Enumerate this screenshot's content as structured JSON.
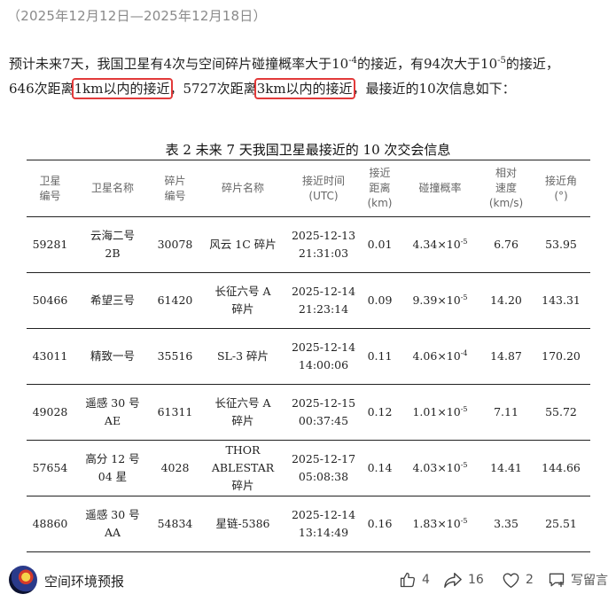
{
  "date_range": "（2025年12月12日—2025年12月18日）",
  "intro": {
    "p1": "预计未来7天，我国卫星有4次与空间碎片碰撞概率大于10",
    "exp1": "-4",
    "p2": "的接近，有94次大于10",
    "exp2": "-5",
    "p3": "的接近，",
    "p4": "646次距离",
    "highlight1": "1km以内的接近",
    "p5": "，5727次距离",
    "highlight2": "3km以内的接近",
    "p6": "，最接近的10次信息如下："
  },
  "table": {
    "title": "表 2  未来 7 天我国卫星最接近的 10 次交会信息",
    "headers": {
      "sat_id": [
        "卫星",
        "编号"
      ],
      "sat_name": [
        "卫星名称"
      ],
      "debris_id": [
        "碎片",
        "编号"
      ],
      "debris_name": [
        "碎片名称"
      ],
      "time": [
        "接近时间",
        "(UTC)"
      ],
      "distance": [
        "接近",
        "距离",
        "(km)"
      ],
      "probability": [
        "碰撞概率"
      ],
      "velocity": [
        "相对",
        "速度",
        "(km/s)"
      ],
      "angle": [
        "接近角",
        "(°)"
      ]
    },
    "rows": [
      {
        "sat_id": "59281",
        "sat_name": [
          "云海二号",
          "2B"
        ],
        "debris_id": "30078",
        "debris_name": [
          "风云  1C 碎片"
        ],
        "time": [
          "2025-12-13",
          "21:31:03"
        ],
        "distance": "0.01",
        "prob_mantissa": "4.34×10",
        "prob_exp": "-5",
        "velocity": "6.76",
        "angle": "53.95"
      },
      {
        "sat_id": "50466",
        "sat_name": [
          "希望三号"
        ],
        "debris_id": "61420",
        "debris_name": [
          "长征六号 A",
          "碎片"
        ],
        "time": [
          "2025-12-14",
          "21:23:14"
        ],
        "distance": "0.09",
        "prob_mantissa": "9.39×10",
        "prob_exp": "-5",
        "velocity": "14.20",
        "angle": "143.31"
      },
      {
        "sat_id": "43011",
        "sat_name": [
          "精致一号"
        ],
        "debris_id": "35516",
        "debris_name": [
          "SL-3  碎片"
        ],
        "time": [
          "2025-12-14",
          "14:00:06"
        ],
        "distance": "0.11",
        "prob_mantissa": "4.06×10",
        "prob_exp": "-4",
        "velocity": "14.87",
        "angle": "170.20"
      },
      {
        "sat_id": "49028",
        "sat_name": [
          "遥感 30 号",
          "AE"
        ],
        "debris_id": "61311",
        "debris_name": [
          "长征六号 A",
          "碎片"
        ],
        "time": [
          "2025-12-15",
          "00:37:45"
        ],
        "distance": "0.12",
        "prob_mantissa": "1.01×10",
        "prob_exp": "-5",
        "velocity": "7.11",
        "angle": "55.72"
      },
      {
        "sat_id": "57654",
        "sat_name": [
          "高分 12 号",
          "04 星"
        ],
        "debris_id": "4028",
        "debris_name": [
          "THOR",
          "ABLESTAR",
          "碎片"
        ],
        "time": [
          "2025-12-17",
          "05:08:38"
        ],
        "distance": "0.14",
        "prob_mantissa": "4.03×10",
        "prob_exp": "-5",
        "velocity": "14.41",
        "angle": "144.66"
      },
      {
        "sat_id": "48860",
        "sat_name": [
          "遥感 30 号",
          "AA"
        ],
        "debris_id": "54834",
        "debris_name": [
          "星链-5386"
        ],
        "time": [
          "2025-12-14",
          "13:14:49"
        ],
        "distance": "0.16",
        "prob_mantissa": "1.83×10",
        "prob_exp": "-5",
        "velocity": "3.35",
        "angle": "25.51"
      }
    ]
  },
  "footer": {
    "author": "空间环境预报",
    "likes": "4",
    "shares": "16",
    "favorites": "2",
    "comment_label": "写留言"
  },
  "icons": [
    "thumbs-up-icon",
    "share-icon",
    "heart-icon",
    "comment-icon"
  ],
  "colors": {
    "highlight_border": "#e23a3a",
    "muted_text": "#8a8a8a"
  }
}
